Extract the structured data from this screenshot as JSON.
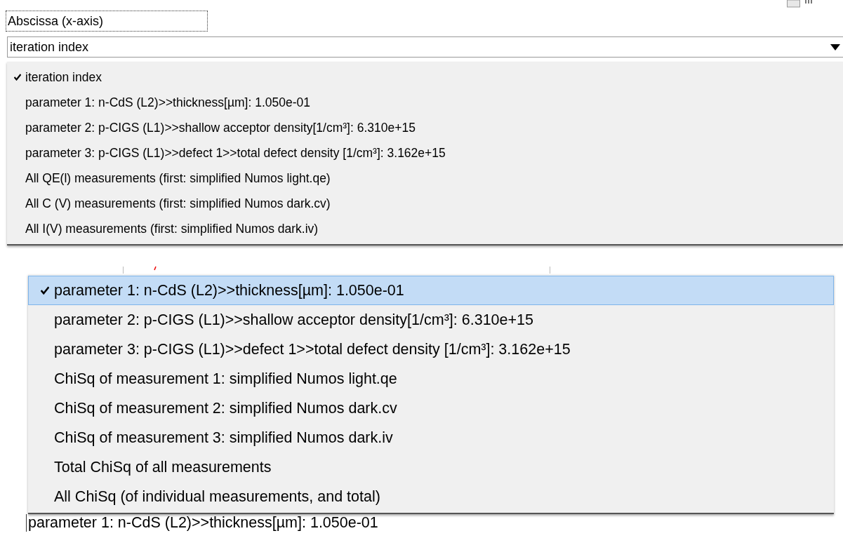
{
  "abscissa_label": "Abscissa (x-axis)",
  "abscissa_combo": {
    "value": "iteration index",
    "expanded": true
  },
  "abscissa_menu": [
    {
      "label": "iteration index",
      "checked": true,
      "selected": false
    },
    {
      "label": "parameter 1: n-CdS (L2)>>thickness[µm]: 1.050e-01",
      "checked": false,
      "selected": false
    },
    {
      "label": "parameter 2: p-CIGS (L1)>>shallow acceptor density[1/cm³]: 6.310e+15",
      "checked": false,
      "selected": false
    },
    {
      "label": "parameter 3: p-CIGS (L1)>>defect 1>>total defect density [1/cm³]: 3.162e+15",
      "checked": false,
      "selected": false
    },
    {
      "label": "All QE(l) measurements (first: simplified Numos light.qe)",
      "checked": false,
      "selected": false
    },
    {
      "label": "All C (V) measurements (first: simplified Numos dark.cv)",
      "checked": false,
      "selected": false
    },
    {
      "label": "All I(V) measurements (first: simplified Numos dark.iv)",
      "checked": false,
      "selected": false
    }
  ],
  "ordinate_menu": [
    {
      "label": "parameter 1: n-CdS (L2)>>thickness[µm]: 1.050e-01",
      "checked": true,
      "selected": true
    },
    {
      "label": "parameter 2: p-CIGS (L1)>>shallow acceptor density[1/cm³]: 6.310e+15",
      "checked": false,
      "selected": false
    },
    {
      "label": "parameter 3: p-CIGS (L1)>>defect 1>>total defect density [1/cm³]: 3.162e+15",
      "checked": false,
      "selected": false
    },
    {
      "label": "ChiSq of measurement 1: simplified Numos light.qe",
      "checked": false,
      "selected": false
    },
    {
      "label": "ChiSq of measurement 2: simplified Numos dark.cv",
      "checked": false,
      "selected": false
    },
    {
      "label": "ChiSq of measurement 3: simplified Numos dark.iv",
      "checked": false,
      "selected": false
    },
    {
      "label": "Total ChiSq of all measurements",
      "checked": false,
      "selected": false
    },
    {
      "label": "All ChiSq (of individual measurements, and total)",
      "checked": false,
      "selected": false
    }
  ],
  "ordinate_combo": {
    "value": "parameter 1: n-CdS (L2)>>thickness[µm]: 1.050e-01"
  }
}
